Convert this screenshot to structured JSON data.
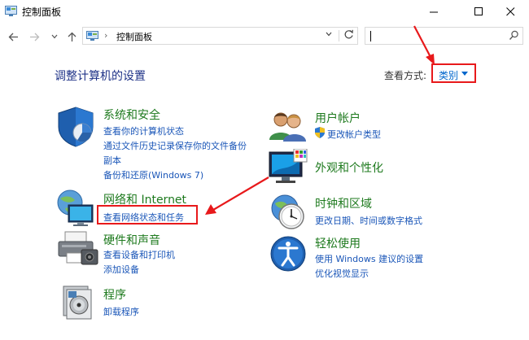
{
  "window": {
    "title": "控制面板"
  },
  "address": {
    "crumb": "控制面板",
    "separator": "›"
  },
  "search": {
    "placeholder": ""
  },
  "main": {
    "heading": "调整计算机的设置",
    "view_by": {
      "label": "查看方式:",
      "value": "类别"
    }
  },
  "left": [
    {
      "title": "系统和安全",
      "links": [
        "查看你的计算机状态",
        "通过文件历史记录保存你的文件备份",
        "副本",
        "备份和还原(Windows 7)"
      ]
    },
    {
      "title": "网络和 Internet",
      "links": [
        "查看网络状态和任务"
      ]
    },
    {
      "title": "硬件和声音",
      "links": [
        "查看设备和打印机",
        "添加设备"
      ]
    },
    {
      "title": "程序",
      "links": [
        "卸载程序"
      ]
    }
  ],
  "right": [
    {
      "title": "用户帐户",
      "links": [
        "更改帐户类型"
      ]
    },
    {
      "title": "外观和个性化",
      "links": []
    },
    {
      "title": "时钟和区域",
      "links": [
        "更改日期、时间或数字格式"
      ]
    },
    {
      "title": "轻松使用",
      "links": [
        "使用 Windows 建议的设置",
        "优化视觉显示"
      ]
    }
  ],
  "colors": {
    "accent_link": "#1a56b8",
    "category_title": "#1e7a1e",
    "heading": "#1e3287",
    "annotation": "#e8191b"
  }
}
